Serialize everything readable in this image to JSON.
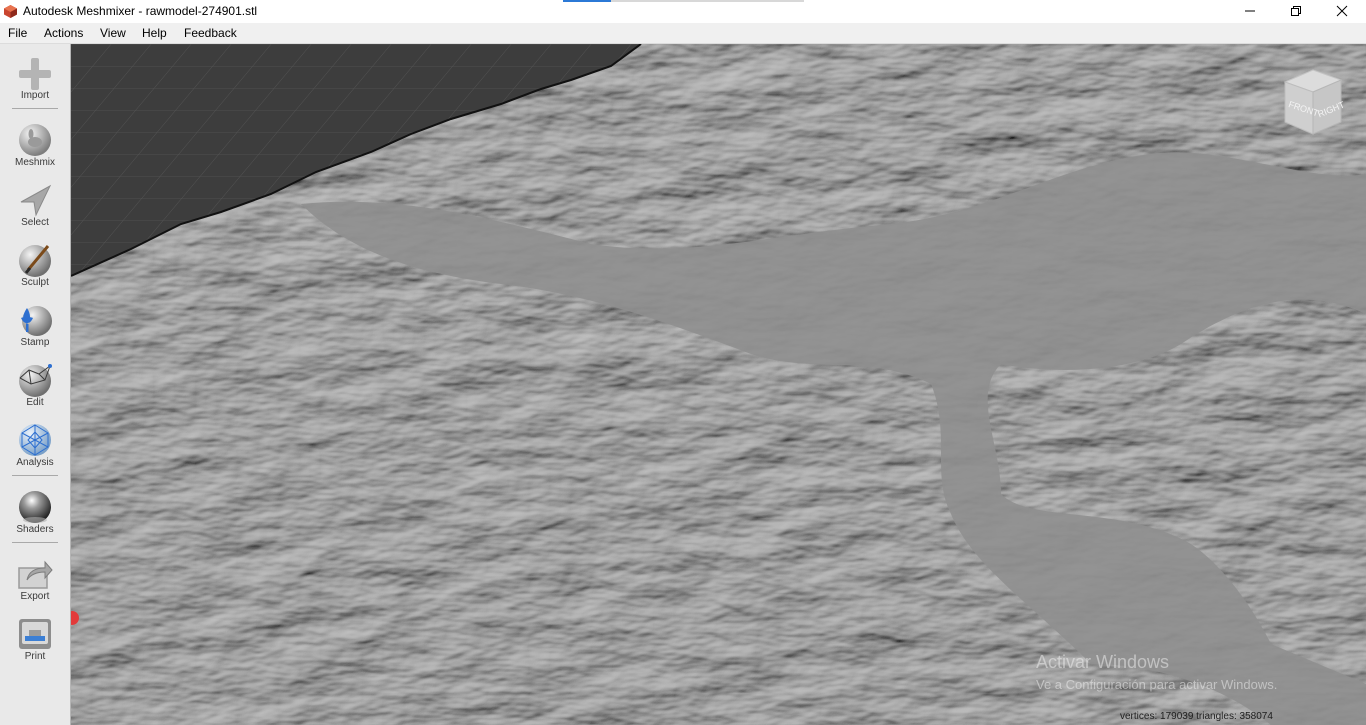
{
  "window": {
    "title": "Autodesk Meshmixer - rawmodel-274901.stl",
    "app_icon": "meshmixer-logo-icon",
    "controls": [
      "minimize-icon",
      "maximize-icon",
      "close-icon"
    ]
  },
  "menu": {
    "items": [
      "File",
      "Actions",
      "View",
      "Help",
      "Feedback"
    ]
  },
  "sidebar": {
    "tools": [
      {
        "label": "Import",
        "icon": "plus-icon"
      },
      {
        "label": "Meshmix",
        "icon": "bunny-ball-icon"
      },
      {
        "label": "Select",
        "icon": "arrow-cursor-icon"
      },
      {
        "label": "Sculpt",
        "icon": "brush-ball-icon"
      },
      {
        "label": "Stamp",
        "icon": "fleur-ball-icon"
      },
      {
        "label": "Edit",
        "icon": "wireframe-ball-icon"
      },
      {
        "label": "Analysis",
        "icon": "mesh-ball-icon"
      },
      {
        "label": "Shaders",
        "icon": "chrome-ball-icon"
      },
      {
        "label": "Export",
        "icon": "export-box-icon"
      },
      {
        "label": "Print",
        "icon": "printer-icon"
      }
    ]
  },
  "viewcube": {
    "front": "FRONT",
    "right": "RIGHT"
  },
  "watermark": {
    "line1": "Activar Windows",
    "line2": "Ve a Configuración para activar Windows."
  },
  "status": {
    "text": "vertices: 179039 triangles: 358074"
  },
  "colors": {
    "grid_bg": "#3c3c3c",
    "terrain": "#8a8a8a",
    "sidebar": "#e9e9e9",
    "accent": "#2b79d6"
  }
}
